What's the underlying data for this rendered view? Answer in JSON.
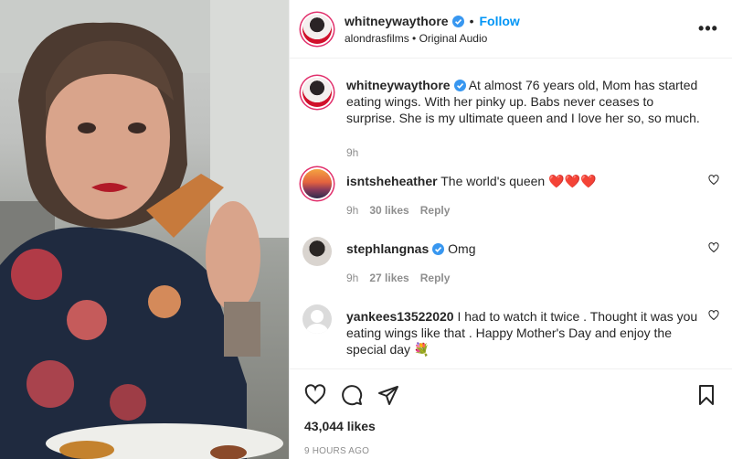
{
  "header": {
    "username": "whitneywaythore",
    "follow_label": "Follow",
    "dot": "•",
    "sub_account": "alondrasfilms",
    "sub_sep": "•",
    "audio": "Original Audio",
    "more": "•••"
  },
  "caption": {
    "username": "whitneywaythore",
    "text": "At almost 76 years old, Mom has started eating wings. With her pinky up. Babs never ceases to surprise. She is my ultimate queen and I love her so, so much.",
    "age": "9h"
  },
  "comments": [
    {
      "username": "isntsheheather",
      "text": "The world's queen ❤️❤️❤️",
      "age": "9h",
      "likes": "30 likes",
      "reply": "Reply",
      "verified": false
    },
    {
      "username": "stephlangnas",
      "text": "Omg",
      "age": "9h",
      "likes": "27 likes",
      "reply": "Reply",
      "verified": true
    },
    {
      "username": "yankees13522020",
      "text": "I had to watch it twice . Thought it was you eating wings like that . Happy Mother's Day and enjoy the special day 💐",
      "verified": false
    }
  ],
  "footer": {
    "likes": "43,044 likes",
    "timestamp": "9 HOURS AGO"
  },
  "colors": {
    "accent": "#0095f6",
    "text": "#262626",
    "muted": "#8e8e8e",
    "border": "#efefef"
  }
}
